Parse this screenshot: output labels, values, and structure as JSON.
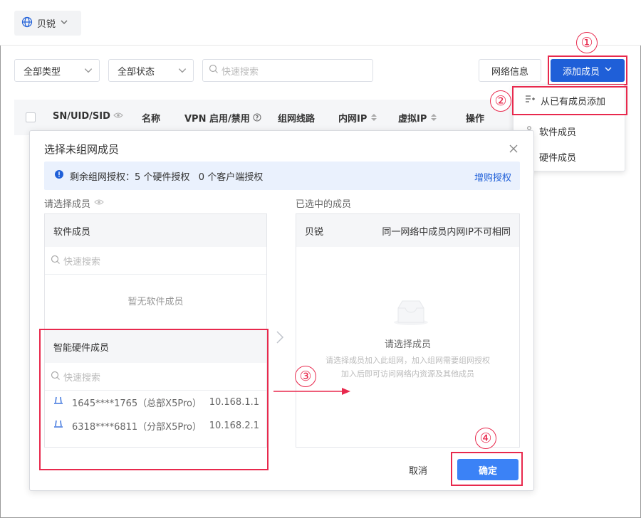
{
  "topbar": {
    "network_name": "贝锐"
  },
  "filters": {
    "type_select": "全部类型",
    "status_select": "全部状态",
    "search_placeholder": "快速搜索",
    "network_info_button": "网络信息",
    "add_member_button": "添加成员"
  },
  "table": {
    "headers": [
      "SN/UID/SID",
      "名称",
      "VPN 启用/禁用",
      "组网线路",
      "内网IP",
      "虚拟IP",
      "操作"
    ]
  },
  "dropdown": {
    "items": [
      "从已有成员添加",
      "软件成员",
      "硬件成员"
    ]
  },
  "modal": {
    "title": "选择未组网成员",
    "alert_text": "剩余组网授权：5 个硬件授权   0 个客户端授权",
    "alert_link": "增购授权",
    "left_label": "请选择成员",
    "right_label": "已选中的成员",
    "software_panel": {
      "title": "软件成员",
      "search_placeholder": "快速搜索",
      "empty_text": "暂无软件成员"
    },
    "hardware_panel": {
      "title": "智能硬件成员",
      "search_placeholder": "快速搜索",
      "members": [
        {
          "name": "1645****1765（总部X5Pro）",
          "ip": "10.168.1.1"
        },
        {
          "name": "6318****6811（分部X5Pro）",
          "ip": "10.168.2.1"
        }
      ]
    },
    "selected_panel": {
      "col1": "贝锐",
      "col2": "同一网络中成员内网IP不可相同",
      "empty_title": "请选择成员",
      "empty_desc_1": "请选择成员加入此组网，加入组网需要组网授权",
      "empty_desc_2": "加入后即可访问网络内资源及其他成员"
    },
    "cancel_button": "取消",
    "confirm_button": "确定"
  },
  "annotations": [
    "①",
    "②",
    "③",
    "④"
  ],
  "colors": {
    "primary": "#1f5fd8",
    "confirm": "#3b82f6",
    "annotation": "#e8294d"
  }
}
